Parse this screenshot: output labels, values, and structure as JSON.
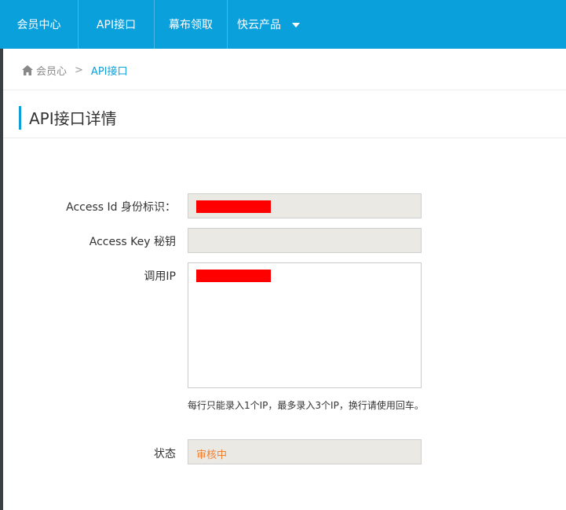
{
  "nav": {
    "items": [
      {
        "label": "会员中心"
      },
      {
        "label": "API接口"
      },
      {
        "label": "幕布领取"
      },
      {
        "label": "快云产品"
      }
    ]
  },
  "breadcrumb": {
    "home_label": "会员心",
    "separator": ">",
    "current_label": "API接口"
  },
  "page": {
    "title": "API接口详情"
  },
  "form": {
    "access_id": {
      "label": "Access Id 身份标识：",
      "value": ""
    },
    "access_key": {
      "label": "Access Key 秘钥",
      "value": ""
    },
    "ip": {
      "label": "调用IP",
      "hint": "每行只能录入1个IP，最多录入3个IP，换行请使用回车。"
    },
    "status": {
      "label": "状态",
      "value": "审核中"
    }
  },
  "colors": {
    "accent": "#0aa0dc",
    "redaction": "#ff0000",
    "status": "#f08030"
  }
}
